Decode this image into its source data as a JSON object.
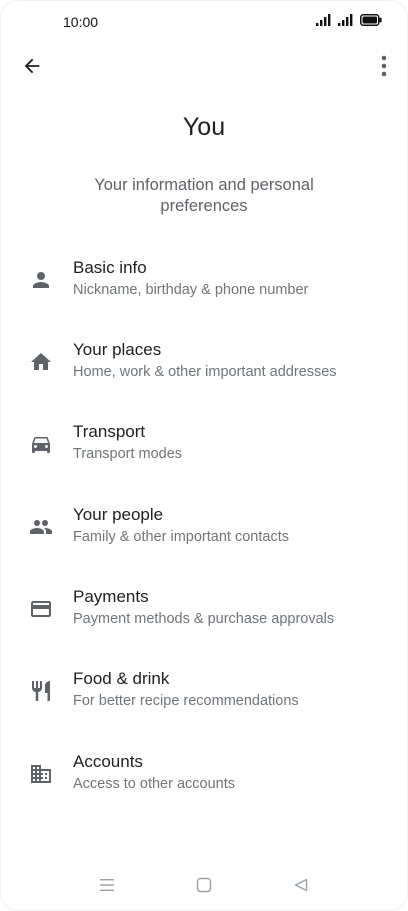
{
  "status_bar": {
    "time": "10:00"
  },
  "top_bar": {
    "back_icon": "arrow-back-icon",
    "more_icon": "more-vert-icon"
  },
  "page": {
    "title": "You",
    "subtitle": "Your information and personal preferences"
  },
  "menu": [
    {
      "title": "Basic info",
      "description": "Nickname, birthday & phone number",
      "icon": "person-icon"
    },
    {
      "title": "Your places",
      "description": "Home, work & other important addresses",
      "icon": "home-icon"
    },
    {
      "title": "Transport",
      "description": "Transport modes",
      "icon": "car-icon"
    },
    {
      "title": "Your people",
      "description": "Family & other important contacts",
      "icon": "people-icon"
    },
    {
      "title": "Payments",
      "description": "Payment methods & purchase approvals",
      "icon": "credit-card-icon"
    },
    {
      "title": "Food & drink",
      "description": "For better recipe recommendations",
      "icon": "restaurant-icon"
    },
    {
      "title": "Accounts",
      "description": "Access to other accounts",
      "icon": "business-icon"
    }
  ],
  "colors": {
    "icon": "#5f6368",
    "title": "#202124",
    "description": "#70757a"
  }
}
